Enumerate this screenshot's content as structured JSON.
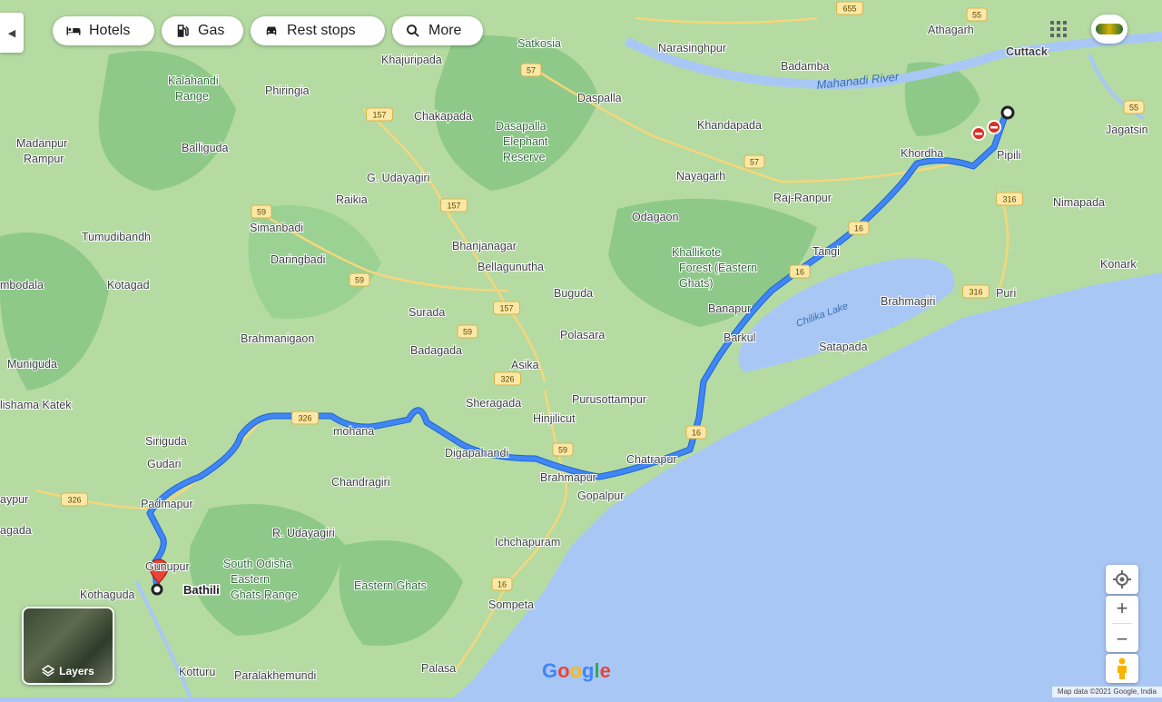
{
  "toolbar": {
    "chips": [
      {
        "label": "Hotels",
        "icon": "bed-icon"
      },
      {
        "label": "Gas",
        "icon": "fuel-pump-icon"
      },
      {
        "label": "Rest stops",
        "icon": "car-icon"
      },
      {
        "label": "More",
        "icon": "search-icon"
      }
    ]
  },
  "map": {
    "origin_label": "Bathili",
    "places": [
      "Cuttack",
      "Athagarh",
      "Satkosia",
      "Narasinghpur",
      "Badamba",
      "Khajuripada",
      "Phiringia",
      "Kalahandi Range",
      "Daspalla",
      "Chakapada",
      "Dasapalla Elephant Reserve",
      "Khandapada",
      "Madanpur Rampur",
      "Balliguda",
      "Khordha",
      "Pipili",
      "Jagatsin",
      "Nayagarh",
      "G. Udayagiri",
      "Raikia",
      "Raj-Ranpur",
      "Nimapada",
      "Odagaon",
      "Simanbadi",
      "Tumudibandh",
      "Khallikote Forest (Eastern Ghats)",
      "Tangi",
      "Bhanjanagar",
      "Daringbadi",
      "Bellagunutha",
      "mbodala",
      "Kotagad",
      "Buguda",
      "Konark",
      "Brahmagiri",
      "Puri",
      "Surada",
      "Banapur",
      "Chilika Lake",
      "Brahmanigaon",
      "Badagada",
      "Polasara",
      "Barkul",
      "Satapada",
      "Muniguda",
      "Asika",
      "Sheragada",
      "Purusottampur",
      "lishama Katek",
      "Hinjilicut",
      "mohana",
      "Siriguda",
      "Digapahandi",
      "Chatrapur",
      "Gudari",
      "Brahmapur",
      "Chandragiri",
      "Gopalpur",
      "aypur",
      "Padmapur",
      "agada",
      "R. Udayagiri",
      "Ichchapuram",
      "Gunupur",
      "South Odisha Eastern Ghats Range",
      "Kothaguda",
      "Eastern Ghats",
      "Sompeta",
      "Kotturu",
      "Paralakhemundi",
      "Palasa"
    ],
    "river": "Mahanadi River",
    "highways": [
      "655",
      "55",
      "57",
      "157",
      "59",
      "326",
      "16",
      "316"
    ]
  },
  "controls": {
    "layers_label": "Layers",
    "zoom_in": "+",
    "zoom_out": "−"
  },
  "brand": "Google",
  "attribution": "Map data ©2021 Google, India",
  "colors": {
    "route": "#4285f4",
    "land": "#b5dba3",
    "forest": "#8fc98a",
    "water": "#a9c7f5",
    "road": "#f6d67a",
    "pin": "#ea4335"
  }
}
